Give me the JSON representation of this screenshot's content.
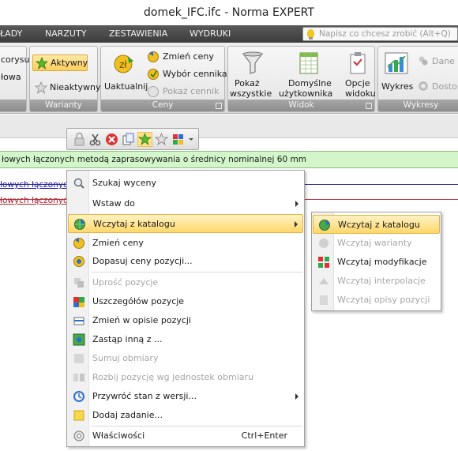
{
  "window": {
    "title": "domek_IFC.ifc - Norma EXPERT"
  },
  "menubar": {
    "items": [
      "ŁADY",
      "NARZUTY",
      "ZESTAWIENIA",
      "WYDRUKI"
    ],
    "tell_placeholder": "Napisz co chcesz zrobić (Alt+Q)"
  },
  "ribbon": {
    "partial": {
      "label_top": "corysu",
      "label_bottom": "łowa"
    },
    "warianty": {
      "caption": "Warianty",
      "active": "Aktywny",
      "inactive": "Nieaktywny"
    },
    "ceny": {
      "caption": "Ceny",
      "update": "Uaktualnij",
      "change_prices": "Zmień ceny",
      "price_list": "Wybór cennika",
      "show_price_list": "Pokaż cennik"
    },
    "widok": {
      "caption": "Widok",
      "show_all_1": "Pokaż",
      "show_all_2": "wszystkie",
      "default_1": "Domyślne",
      "default_2": "użytkownika",
      "options_1": "Opcje",
      "options_2": "widoku"
    },
    "wykresy": {
      "caption": "Wykresy",
      "charts": "Wykres",
      "data": "Dane",
      "access": "Dostos"
    }
  },
  "content": {
    "green_row": "łowych łączonych metodą zaprasowywania o średnicy nominalnej 60 mm",
    "row_blue": "łowych łączonych",
    "row_red": "łowych łączonych"
  },
  "context_menu": {
    "items": [
      {
        "label": "Szukaj wyceny",
        "disabled": false,
        "submenu": false
      },
      {
        "label": "Wstaw do",
        "disabled": false,
        "submenu": true
      },
      {
        "label": "Wczytaj z katalogu",
        "disabled": false,
        "submenu": true,
        "highlighted": true
      },
      {
        "label": "Zmień ceny",
        "disabled": false,
        "submenu": false
      },
      {
        "label": "Dopasuj ceny pozycji...",
        "disabled": false,
        "submenu": false
      },
      {
        "label": "Uprość pozycje",
        "disabled": true,
        "submenu": false
      },
      {
        "label": "Uszczegółów pozycje",
        "disabled": false,
        "submenu": false
      },
      {
        "label": "Zmień w opisie pozycji",
        "disabled": false,
        "submenu": false
      },
      {
        "label": "Zastąp inną z ...",
        "disabled": false,
        "submenu": false
      },
      {
        "label": "Sumuj obmiary",
        "disabled": true,
        "submenu": false
      },
      {
        "label": "Rozbij pozycję wg jednostek obmiaru",
        "disabled": true,
        "submenu": false
      },
      {
        "label": "Przywróć stan z wersji...",
        "disabled": false,
        "submenu": true
      },
      {
        "label": "Dodaj zadanie...",
        "disabled": false,
        "submenu": false
      },
      {
        "label": "Właściwości",
        "disabled": false,
        "submenu": false,
        "shortcut": "Ctrl+Enter"
      }
    ]
  },
  "submenu": {
    "items": [
      {
        "label": "Wczytaj z katalogu",
        "disabled": false,
        "highlighted": true
      },
      {
        "label": "Wczytaj warianty",
        "disabled": true
      },
      {
        "label": "Wczytaj modyfikacje",
        "disabled": false
      },
      {
        "label": "Wczytaj interpolacje",
        "disabled": true
      },
      {
        "label": "Wczytaj opisy pozycji",
        "disabled": true
      }
    ]
  },
  "colors": {
    "menu_highlight": "#ffd86a",
    "green_row": "#d2f6c9",
    "link_blue": "#1a1aa0",
    "link_red": "#b0202a"
  }
}
